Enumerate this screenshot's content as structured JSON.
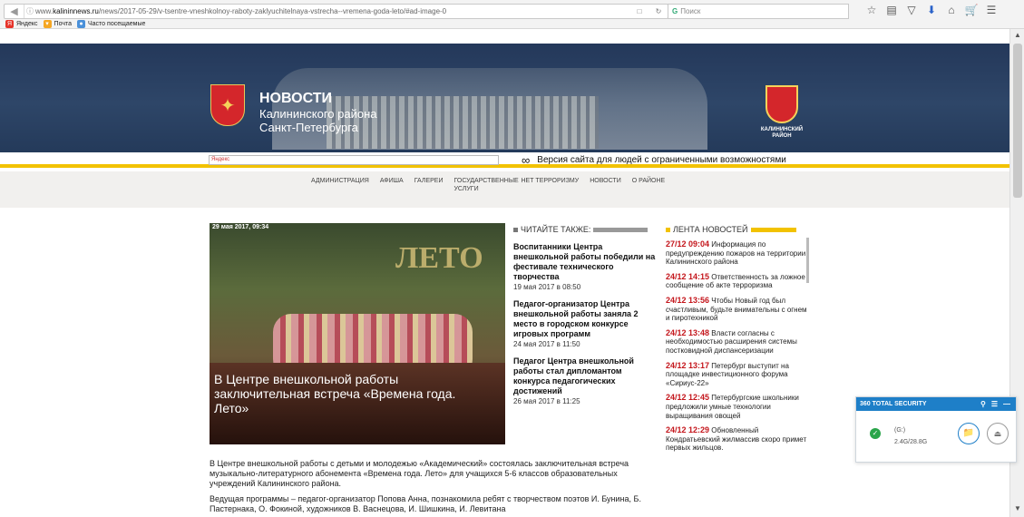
{
  "browser": {
    "url_prefix": "www.",
    "url_domain": "kalininnews.ru",
    "url_path": "/news/2017-05-29/v-tsentre-vneshkolnoy-raboty-zaklyuchitelnaya-vstrecha--vremena-goda-leto/#ad-image-0",
    "search_placeholder": "Поиск",
    "bookmarks": [
      {
        "label": "Яндекс"
      },
      {
        "label": "Почта"
      },
      {
        "label": "Часто посещаемые"
      }
    ]
  },
  "header": {
    "title_line1": "НОВОСТИ",
    "title_line2": "Калининского района",
    "title_line3": "Санкт-Петербурга",
    "crest_label_line1": "КАЛИНИНСКИЙ",
    "crest_label_line2": "РАЙОН"
  },
  "strip": {
    "search_placeholder": "Яндекс",
    "accessibility_text": "Версия сайта для людей с ограниченными возможностями"
  },
  "menu": [
    "АДМИНИСТРАЦИЯ",
    "АФИША",
    "ГАЛЕРЕИ",
    "ГОСУДАРСТВЕННЫЕ УСЛУГИ",
    "НЕТ ТЕРРОРИЗМУ",
    "НОВОСТИ",
    "О РАЙОНЕ"
  ],
  "hero": {
    "date": "29 мая 2017, 09:34",
    "image_text": "ЛЕТО",
    "caption": "В Центре внешкольной работы заключительная встреча «Времена года. Лето»"
  },
  "read_also": {
    "heading": "ЧИТАЙТЕ ТАКЖЕ:",
    "items": [
      {
        "title": "Воспитанники Центра внешкольной работы победили на фестивале технического творчества",
        "date": "19 мая 2017 в 08:50"
      },
      {
        "title": "Педагог-организатор Центра внешкольной работы заняла 2 место в городском конкурсе игровых программ",
        "date": "24 мая 2017 в 11:50"
      },
      {
        "title": "Педагог Центра внешкольной работы стал дипломантом конкурса педагогических достижений",
        "date": "26 мая 2017 в 11:25"
      }
    ]
  },
  "feed": {
    "heading": "ЛЕНТА НОВОСТЕЙ",
    "items": [
      {
        "time": "27/12 09:04",
        "text": "Информация по предупреждению пожаров на территории Калининского района"
      },
      {
        "time": "24/12 14:15",
        "text": "Ответственность за ложное сообщение об акте терроризма"
      },
      {
        "time": "24/12 13:56",
        "text": "Чтобы Новый год был счастливым, будьте внимательны с огнем и пиротехникой"
      },
      {
        "time": "24/12 13:48",
        "text": "Власти согласны с необходимостью расширения системы постковидной диспансеризации"
      },
      {
        "time": "24/12 13:17",
        "text": "Петербург выступит на площадке инвестиционного форума «Сириус-22»"
      },
      {
        "time": "24/12 12:45",
        "text": "Петербургские школьники предложили умные технологии выращивания овощей"
      },
      {
        "time": "24/12 12:29",
        "text": "Обновленный Кондратьевский жилмассив скоро примет первых жильцов."
      }
    ]
  },
  "article": {
    "p1": "В Центре внешкольной работы с детьми и молодежью «Академический» состоялась заключительная встреча музыкально-литературного абонемента «Времена года. Лето» для учащихся 5-6 классов образовательных учреждений Калининского района.",
    "p2": "Ведущая программы – педагог-организатор Попова Анна, познакомила ребят с творчеством поэтов И. Бунина, Б. Пастернака, О. Фокиной, художников В. Васнецова, И. Шишкина, И. Левитана"
  },
  "security": {
    "title": "360 TOTAL SECURITY",
    "drive": "(G:)",
    "usage": "2.4G/28.8G"
  }
}
